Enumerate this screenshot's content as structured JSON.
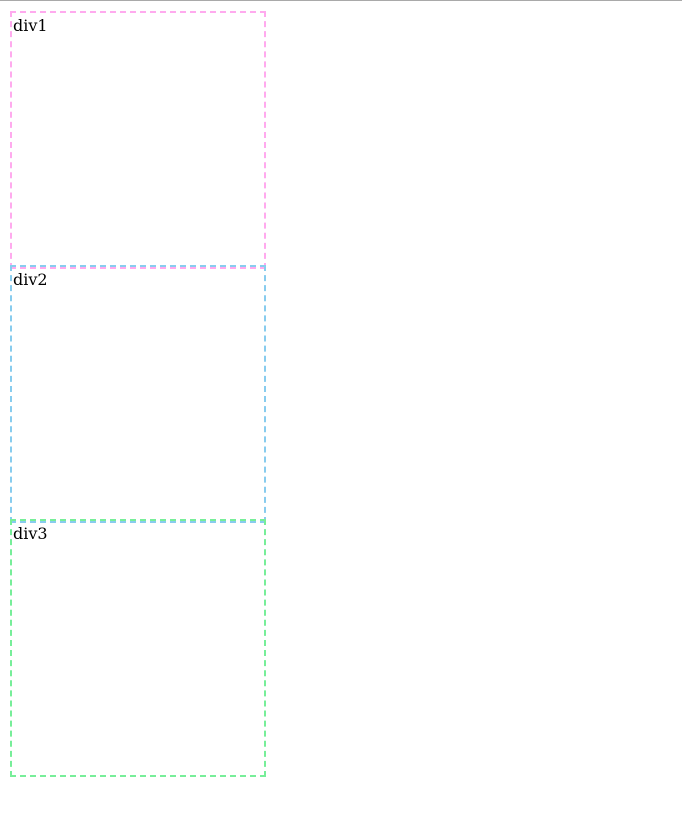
{
  "boxes": [
    {
      "label": "div1",
      "border_color": "#ffaaee"
    },
    {
      "label": "div2",
      "border_color": "#88ccee"
    },
    {
      "label": "div3",
      "border_color": "#77ee99"
    }
  ],
  "colors": {
    "background": "#ffffff",
    "top_rule": "#a9a9a9",
    "text": "#000000"
  }
}
